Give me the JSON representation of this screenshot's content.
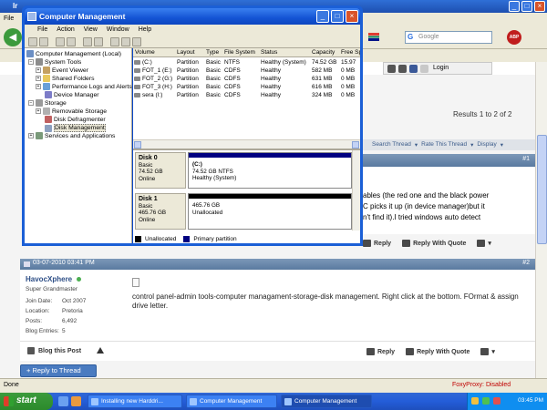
{
  "browser": {
    "title": "Ir",
    "menu": [
      "File",
      "E"
    ],
    "search_placeholder": "Google",
    "abp_label": "ABP",
    "login_label": "Login",
    "status_text": "Done",
    "foxyproxy": "FoxyProxy: Disabled"
  },
  "forum": {
    "results": "Results 1 to 2 of 2",
    "thread_tools": [
      "Search Thread",
      "Rate This Thread",
      "Display"
    ],
    "post1": {
      "number": "#1",
      "text_lines": [
        "ables (the red one and the black power",
        "C picks it up (in device manager)but it",
        "n't find it).I tried windows auto detect"
      ]
    },
    "reply_label": "Reply",
    "reply_quote_label": "Reply With Quote",
    "post2": {
      "date": "03-07-2010 03:41 PM",
      "number": "#2",
      "username": "HavocXphere",
      "user_title": "Super Grandmaster",
      "join_label": "Join Date:",
      "join_value": "Oct 2007",
      "location_label": "Location:",
      "location_value": "Pretoria",
      "posts_label": "Posts:",
      "posts_value": "6,492",
      "blog_label": "Blog Entries:",
      "blog_value": "5",
      "text": "control panel-admin tools-computer managament-storage-disk management. Right click at the bottom. FOrmat & assign drive letter.",
      "blog_post": "Blog this Post"
    },
    "reply_thread": "+ Reply to Thread"
  },
  "cm": {
    "title": "Computer Management",
    "menu": [
      "File",
      "Action",
      "View",
      "Window",
      "Help"
    ],
    "tree": [
      {
        "label": "Computer Management (Local)"
      },
      {
        "label": "System Tools"
      },
      {
        "label": "Event Viewer"
      },
      {
        "label": "Shared Folders"
      },
      {
        "label": "Performance Logs and Alerts"
      },
      {
        "label": "Device Manager"
      },
      {
        "label": "Storage"
      },
      {
        "label": "Removable Storage"
      },
      {
        "label": "Disk Defragmenter"
      },
      {
        "label": "Disk Management"
      },
      {
        "label": "Services and Applications"
      }
    ],
    "columns": [
      "Volume",
      "Layout",
      "Type",
      "File System",
      "Status",
      "Capacity",
      "Free Sp"
    ],
    "volumes": [
      {
        "volume": "(C:)",
        "layout": "Partition",
        "type": "Basic",
        "fs": "NTFS",
        "status": "Healthy (System)",
        "capacity": "74.52 GB",
        "free": "15.97"
      },
      {
        "volume": "FOT_1 (E:)",
        "layout": "Partition",
        "type": "Basic",
        "fs": "CDFS",
        "status": "Healthy",
        "capacity": "582 MB",
        "free": "0 MB"
      },
      {
        "volume": "FOT_2 (G:)",
        "layout": "Partition",
        "type": "Basic",
        "fs": "CDFS",
        "status": "Healthy",
        "capacity": "631 MB",
        "free": "0 MB"
      },
      {
        "volume": "FOT_3 (H:)",
        "layout": "Partition",
        "type": "Basic",
        "fs": "CDFS",
        "status": "Healthy",
        "capacity": "616 MB",
        "free": "0 MB"
      },
      {
        "volume": "sera (I:)",
        "layout": "Partition",
        "type": "Basic",
        "fs": "CDFS",
        "status": "Healthy",
        "capacity": "324 MB",
        "free": "0 MB"
      }
    ],
    "disk0": {
      "name": "Disk 0",
      "type": "Basic",
      "size": "74.52 GB",
      "status": "Online",
      "part_name": "(C:)",
      "part_size": "74.52 GB NTFS",
      "part_status": "Healthy (System)"
    },
    "disk1": {
      "name": "Disk 1",
      "type": "Basic",
      "size": "465.76 GB",
      "status": "Online",
      "part_size": "465.76 GB",
      "part_status": "Unallocated"
    },
    "legend": [
      "Unallocated",
      "Primary partition"
    ]
  },
  "taskbar": {
    "start": "start",
    "tasks": [
      "Installing new Harddri...",
      "Computer Management",
      "Computer Management"
    ],
    "clock": "03:45 PM"
  },
  "colors": {
    "primary_partition": "#000080",
    "unallocated": "#000000",
    "xp_blue": "#245dd8",
    "start_green": "#3c9b3c"
  }
}
